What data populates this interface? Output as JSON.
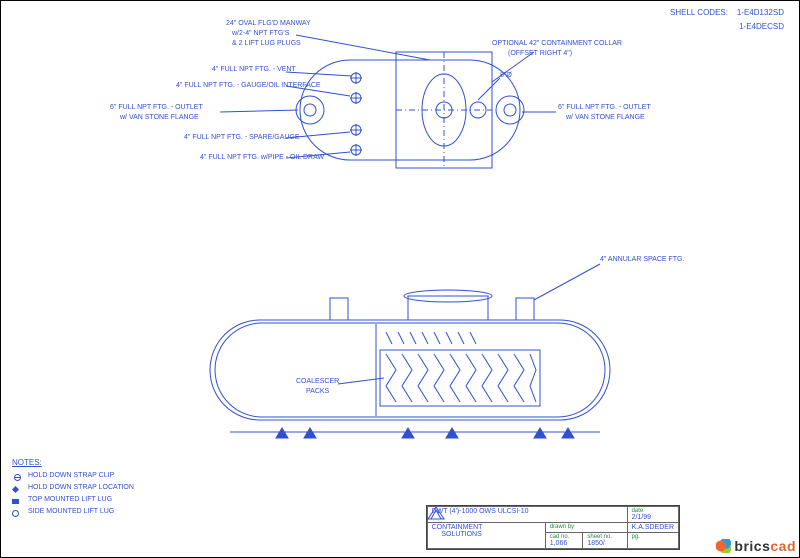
{
  "header": {
    "shell_codes_label": "SHELL CODES:",
    "code1": "1-E4D132SD",
    "code2": "1-E4DECSD"
  },
  "top_view": {
    "callout_manway": "24\" OVAL FLG'D MANWAY",
    "callout_manway2": "w/2-4\" NPT FTG'S",
    "callout_manway3": "& 2 LIFT LUG PLUGS",
    "callout_vent": "4\" FULL NPT FTG. - VENT",
    "callout_interface": "4\" FULL NPT FTG. - GAUGE/OIL INTERFACE",
    "callout_outlet_left": "6\" FULL NPT FTG. - OUTLET",
    "callout_vanstone_left": "w/ VAN STONE FLANGE",
    "callout_gauge": "4\" FULL NPT FTG. - SPARE/GAUGE",
    "callout_oildraw": "4\" FULL NPT FTG. w/PIPE - OIL DRAW",
    "callout_collar": "OPTIONAL 42\" CONTAINMENT COLLAR",
    "callout_collar2": "(OFFSET RIGHT 4\")",
    "callout_8dia": "8\"Ø",
    "callout_outlet_right": "6\" FULL NPT FTG. - OUTLET",
    "callout_vanstone_right": "w/ VAN STONE FLANGE"
  },
  "side_view": {
    "callout_annular": "4\" ANNULAR SPACE FTG.",
    "callout_packs": "COALESCER",
    "callout_packs2": "PACKS"
  },
  "notes": {
    "title": "NOTES:",
    "items": [
      "HOLD DOWN STRAP CLIP",
      "HOLD DOWN STRAP LOCATION",
      "TOP MOUNTED LIFT LUG",
      "SIDE MOUNTED LIFT LUG"
    ]
  },
  "titleblock": {
    "title": "DWT (4')-1000 OWS ULCSI-10",
    "date_lbl": "date",
    "date": "2/1/99",
    "drawn_lbl": "drawn by",
    "drawn": "K.A.SDEDER",
    "company": "CONTAINMENT",
    "company2": "SOLUTIONS",
    "cad_lbl": "cad no.",
    "cad": "1,066",
    "sheet_lbl": "sheet no.",
    "sheet": "1850/",
    "page_lbl": "pg.",
    "page": ""
  },
  "branding": {
    "name": "bricscad"
  }
}
